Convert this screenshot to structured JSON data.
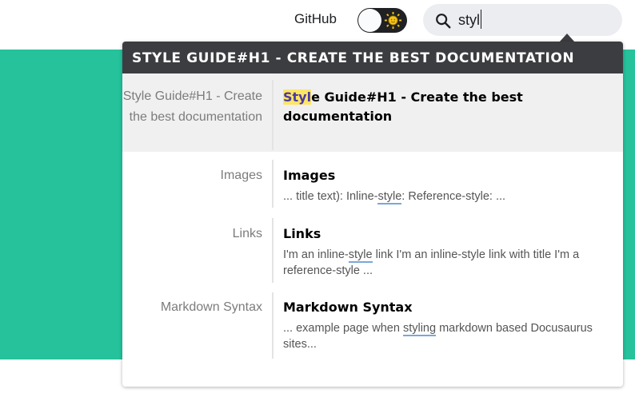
{
  "header": {
    "github_label": "GitHub",
    "search_value": "styl"
  },
  "dropdown": {
    "section_title": "STYLE GUIDE#H1 - CREATE THE BEST DOCUMENTATION",
    "results": [
      {
        "category": "Style Guide#H1 - Create the best documentation",
        "title_highlight": "Styl",
        "title_rest": "e Guide#H1 - Create the best documentation",
        "snippet_pre": "",
        "snippet_match": "",
        "snippet_post": ""
      },
      {
        "category": "Images",
        "title": "Images",
        "snippet_pre": "... title text): Inline-",
        "snippet_match": "style",
        "snippet_post": ": Reference-style: ..."
      },
      {
        "category": "Links",
        "title": "Links",
        "snippet_pre": "I'm an inline-",
        "snippet_match": "style",
        "snippet_post": " link I'm an inline-style link with title I'm a reference-style ..."
      },
      {
        "category": "Markdown Syntax",
        "title": "Markdown Syntax",
        "snippet_pre": "... example page when ",
        "snippet_match": "styling",
        "snippet_post": " markdown based Docusaurus sites..."
      }
    ]
  },
  "colors": {
    "brand_green": "#25c29c",
    "dropdown_header": "#3c3d41",
    "highlight_yellow": "#ffe564"
  },
  "icons": {
    "theme_toggle": "sun-icon",
    "search": "search-icon"
  }
}
